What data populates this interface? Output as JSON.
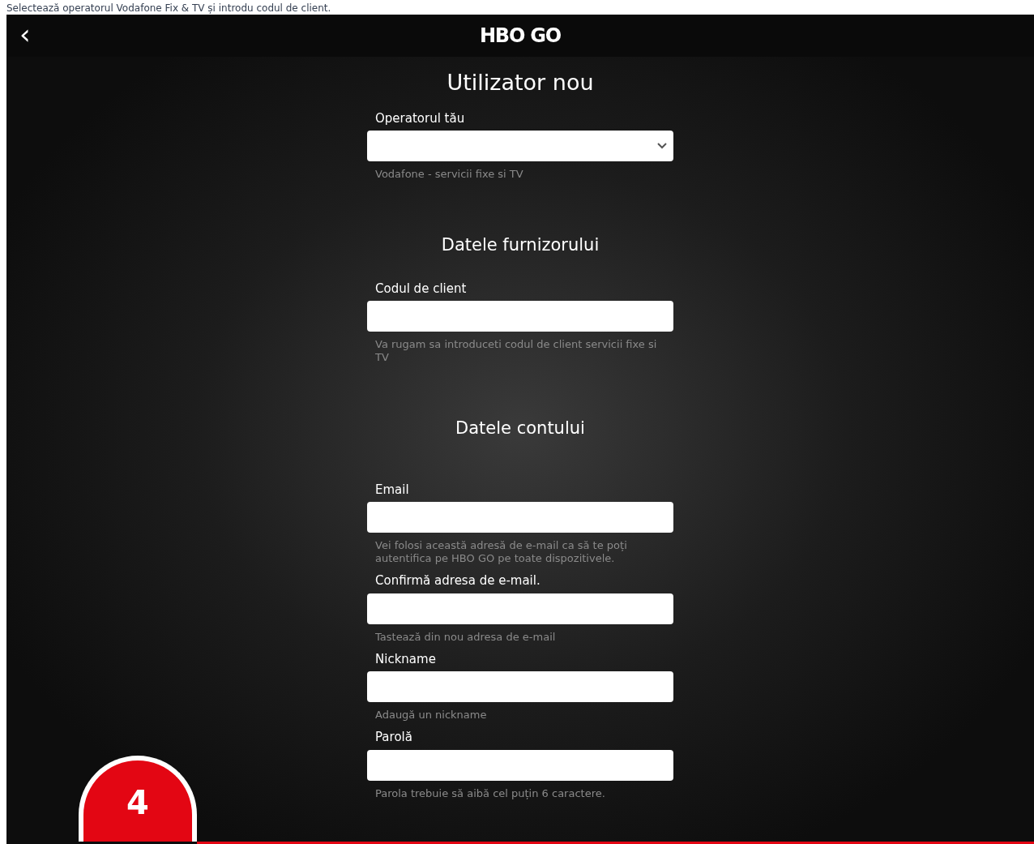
{
  "caption": "Selectează operatorul Vodafone Fix & TV și introdu codul de client.",
  "header": {
    "back": "‹",
    "logo": "HBO GO"
  },
  "title": "Utilizator nou",
  "sections": [
    {
      "fields": [
        {
          "kind": "select",
          "label": "Operatorul tău",
          "hint": "Vodafone - servicii fixe si TV"
        }
      ]
    },
    {
      "heading": "Datele furnizorului",
      "fields": [
        {
          "kind": "text",
          "label": "Codul de client",
          "hint": "Va rugam sa introduceti codul de client servicii fixe si TV"
        }
      ]
    },
    {
      "heading": "Datele contului",
      "fields": [
        {
          "kind": "text",
          "label": "Email",
          "hint": "Vei folosi această adresă de e-mail ca să te poți autentifica pe HBO GO pe toate dispozitivele."
        },
        {
          "kind": "text",
          "label": "Confirmă adresa de e-mail.",
          "hint": "Tastează din nou adresa de e-mail"
        },
        {
          "kind": "text",
          "label": "Nickname",
          "hint": "Adaugă un nickname"
        },
        {
          "kind": "password",
          "label": "Parolă",
          "hint": "Parola trebuie să aibă cel puțin 6 caractere."
        }
      ]
    }
  ],
  "step_badge": "4"
}
